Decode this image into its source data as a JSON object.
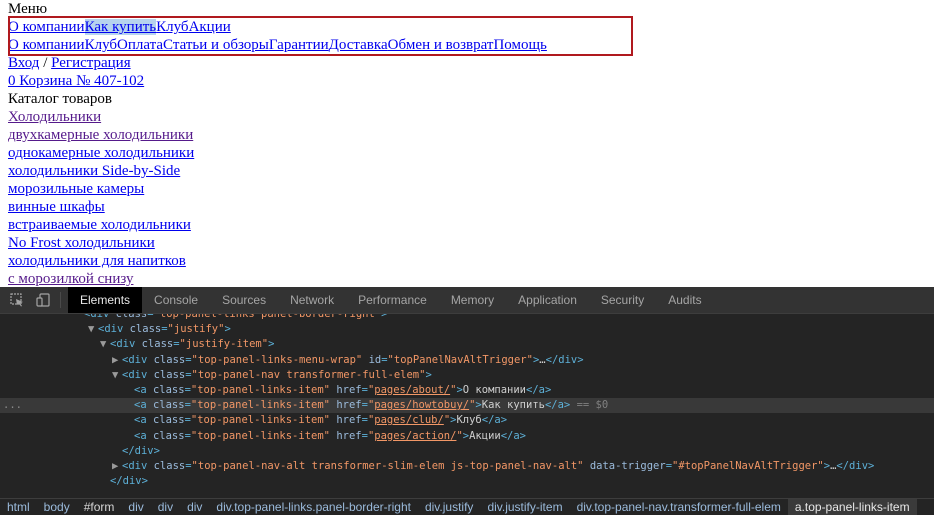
{
  "page": {
    "menu_label": "Меню",
    "menu_row1": [
      "О компании",
      "Как купить",
      "Клуб",
      "Акции"
    ],
    "menu_row2": [
      "О компании",
      "Клуб",
      "Оплата",
      "Статьи и обзоры",
      "Гарантии",
      "Доставка",
      "Обмен и возврат",
      "Помощь"
    ],
    "login": "Вход",
    "login_sep": " / ",
    "register": "Регистрация",
    "cart": "0 Корзина № 407-102",
    "catalog_title": "Каталог товаров",
    "catalog_items": [
      "Холодильники",
      "двухкамерные холодильники",
      "однокамерные холодильники",
      "холодильники Side-by-Side",
      "морозильные камеры",
      "винные шкафы",
      "встраиваемые холодильники",
      "No Frost холодильники",
      "холодильники для напитков",
      "с морозилкой снизу"
    ]
  },
  "devtools": {
    "tabs": [
      "Elements",
      "Console",
      "Sources",
      "Network",
      "Performance",
      "Memory",
      "Application",
      "Security",
      "Audits"
    ],
    "active_tab": "Elements",
    "tree": {
      "l0": "▼<div class=\"top-panel-links panel-border-right\">",
      "l1_tag": "div",
      "l1_class": "justify",
      "l2_class": "justify-item",
      "l3_class": "top-panel-links-menu-wrap",
      "l3_id": "topPanelNavAltTrigger",
      "l4_class": "top-panel-nav transformer-full-elem",
      "links": [
        {
          "class": "top-panel-links-item",
          "href": "pages/about/",
          "text": "О компании"
        },
        {
          "class": "top-panel-links-item",
          "href": "pages/howtobuy/",
          "text": "Как купить"
        },
        {
          "class": "top-panel-links-item",
          "href": "pages/club/",
          "text": "Клуб"
        },
        {
          "class": "top-panel-links-item",
          "href": "pages/action/",
          "text": "Акции"
        }
      ],
      "selected_marker": "== $0",
      "gutter": "...",
      "close_div": "</div>",
      "alt_class": "top-panel-nav-alt transformer-slim-elem js-top-panel-nav-alt",
      "alt_trigger": "#topPanelNavAltTrigger",
      "last_class": "justify-item"
    },
    "breadcrumbs": [
      {
        "text": "html",
        "tagonly": false
      },
      {
        "text": "body",
        "tagonly": false
      },
      {
        "text": "#form",
        "tagonly": true
      },
      {
        "text": "div",
        "tagonly": false
      },
      {
        "text": "div",
        "tagonly": false
      },
      {
        "text": "div",
        "tagonly": false
      },
      {
        "text": "div.top-panel-links.panel-border-right",
        "tagonly": false
      },
      {
        "text": "div.justify",
        "tagonly": false
      },
      {
        "text": "div.justify-item",
        "tagonly": false
      },
      {
        "text": "div.top-panel-nav.transformer-full-elem",
        "tagonly": false
      },
      {
        "text": "a.top-panel-links-item",
        "tagonly": false,
        "active": true
      }
    ]
  }
}
